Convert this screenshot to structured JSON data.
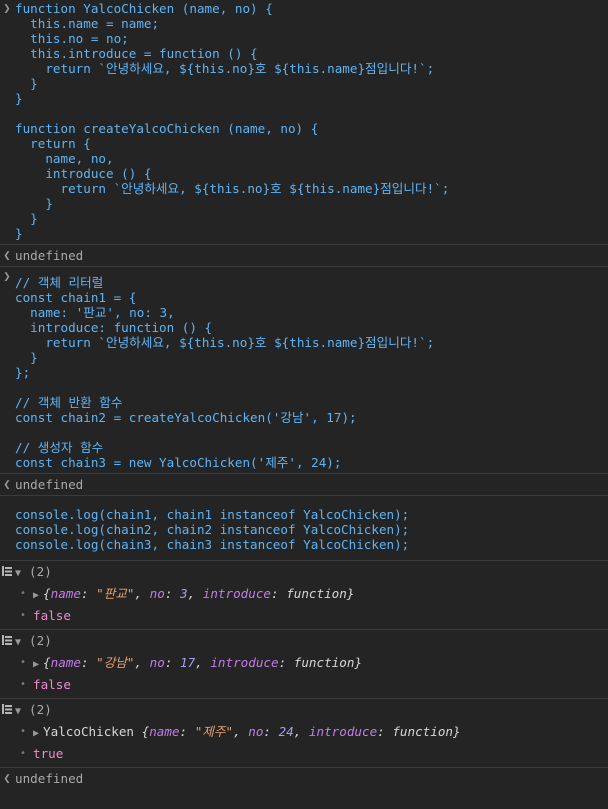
{
  "input1": {
    "lines": [
      "function YalcoChicken (name, no) {",
      "  this.name = name;",
      "  this.no = no;",
      "  this.introduce = function () {",
      "    return `안녕하세요, ${this.no}호 ${this.name}점입니다!`;",
      "  }",
      "}",
      "",
      "function createYalcoChicken (name, no) {",
      "  return {",
      "    name, no,",
      "    introduce () {",
      "      return `안녕하세요, ${this.no}호 ${this.name}점입니다!`;",
      "    }",
      "  }",
      "}"
    ]
  },
  "result1": "undefined",
  "input2": {
    "lines": [
      "// 객체 리터럴",
      "const chain1 = {",
      "  name: '판교', no: 3,",
      "  introduce: function () {",
      "    return `안녕하세요, ${this.no}호 ${this.name}점입니다!`;",
      "  }",
      "};",
      "",
      "// 객체 반환 함수",
      "const chain2 = createYalcoChicken('강남', 17);",
      "",
      "// 생성자 함수",
      "const chain3 = new YalcoChicken('제주', 24);"
    ]
  },
  "result2": "undefined",
  "input3": {
    "lines": [
      "console.log(chain1, chain1 instanceof YalcoChicken);",
      "console.log(chain2, chain2 instanceof YalcoChicken);",
      "console.log(chain3, chain3 instanceof YalcoChicken);"
    ]
  },
  "logs": [
    {
      "count": "(2)",
      "prefix": "",
      "name_key": "name",
      "name_val": "\"판교\"",
      "no_key": "no",
      "no_val": "3",
      "intro_key": "introduce",
      "intro_val": "function",
      "bool": "false"
    },
    {
      "count": "(2)",
      "prefix": "",
      "name_key": "name",
      "name_val": "\"강남\"",
      "no_key": "no",
      "no_val": "17",
      "intro_key": "introduce",
      "intro_val": "function",
      "bool": "false"
    },
    {
      "count": "(2)",
      "prefix": "YalcoChicken ",
      "name_key": "name",
      "name_val": "\"제주\"",
      "no_key": "no",
      "no_val": "24",
      "intro_key": "introduce",
      "intro_val": "function",
      "bool": "true"
    }
  ],
  "result3": "undefined",
  "colors": {
    "background": "#242424",
    "code": "#5fb4f5",
    "key": "#c27ce8",
    "string": "#e6a16b",
    "number": "#a1a1f7",
    "boolean": "#f08ad0"
  },
  "icons": [
    "input-prompt-icon",
    "result-arrow-icon",
    "log-group-icon",
    "expand-triangle-icon",
    "bullet-icon"
  ]
}
